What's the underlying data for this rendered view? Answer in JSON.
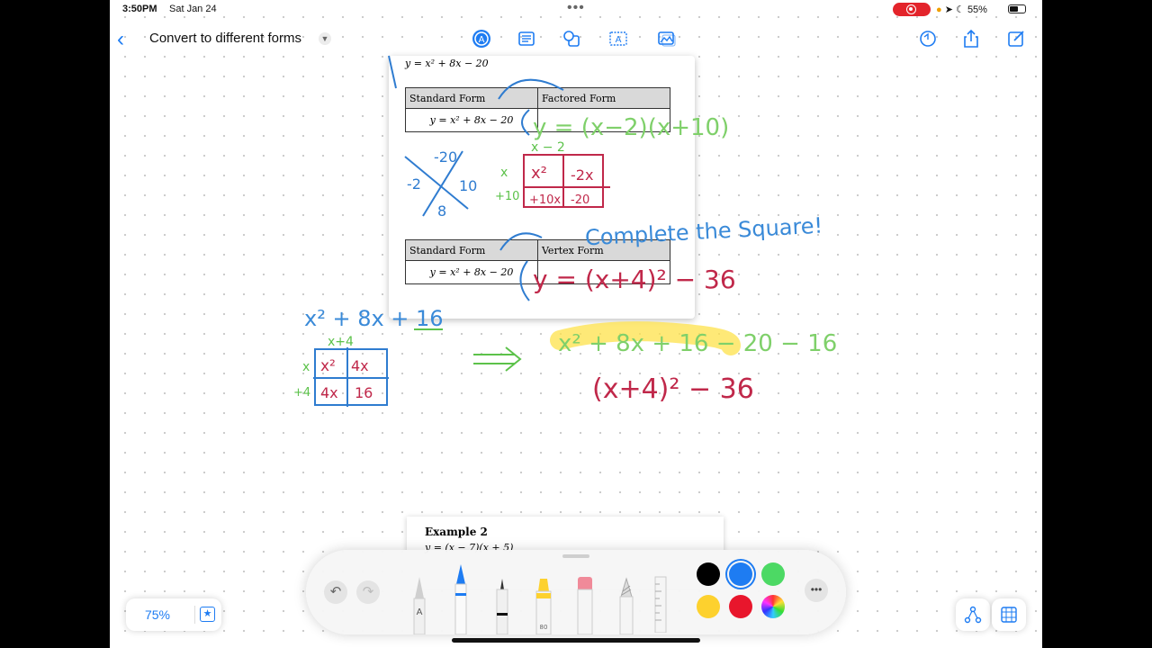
{
  "status_bar": {
    "time": "3:50PM",
    "date": "Sat Jan 24",
    "battery_text": "55%",
    "battery_level": 0.55
  },
  "toolbar": {
    "title": "Convert to different forms"
  },
  "worksheet": {
    "equation_top": "y = x² + 8x − 20",
    "table1": {
      "col1": "Standard Form",
      "col2": "Factored Form",
      "value": "y = x² + 8x − 20"
    },
    "table2": {
      "col1": "Standard Form",
      "col2": "Vertex Form",
      "value": "y = x² + 8x − 20"
    }
  },
  "example2": {
    "title": "Example 2",
    "equation": "y = (x − 7)(x + 5)"
  },
  "handwriting": {
    "factored": "y = (x−2)(x+10)",
    "complete_square": "Complete the Square!",
    "vertex": "y = (x+4)² − 36",
    "expression": "x² + 8x + 16",
    "expanded": "x² + 8x + 16 − 20 − 16",
    "result": "(x+4)² − 36"
  },
  "tools": {
    "pen_labels": [
      "A",
      "80"
    ],
    "colors": [
      "#000000",
      "#1e7cf2",
      "#4cd964",
      "#fdd12e",
      "#e8162c"
    ]
  },
  "zoom": {
    "level": "75%"
  }
}
